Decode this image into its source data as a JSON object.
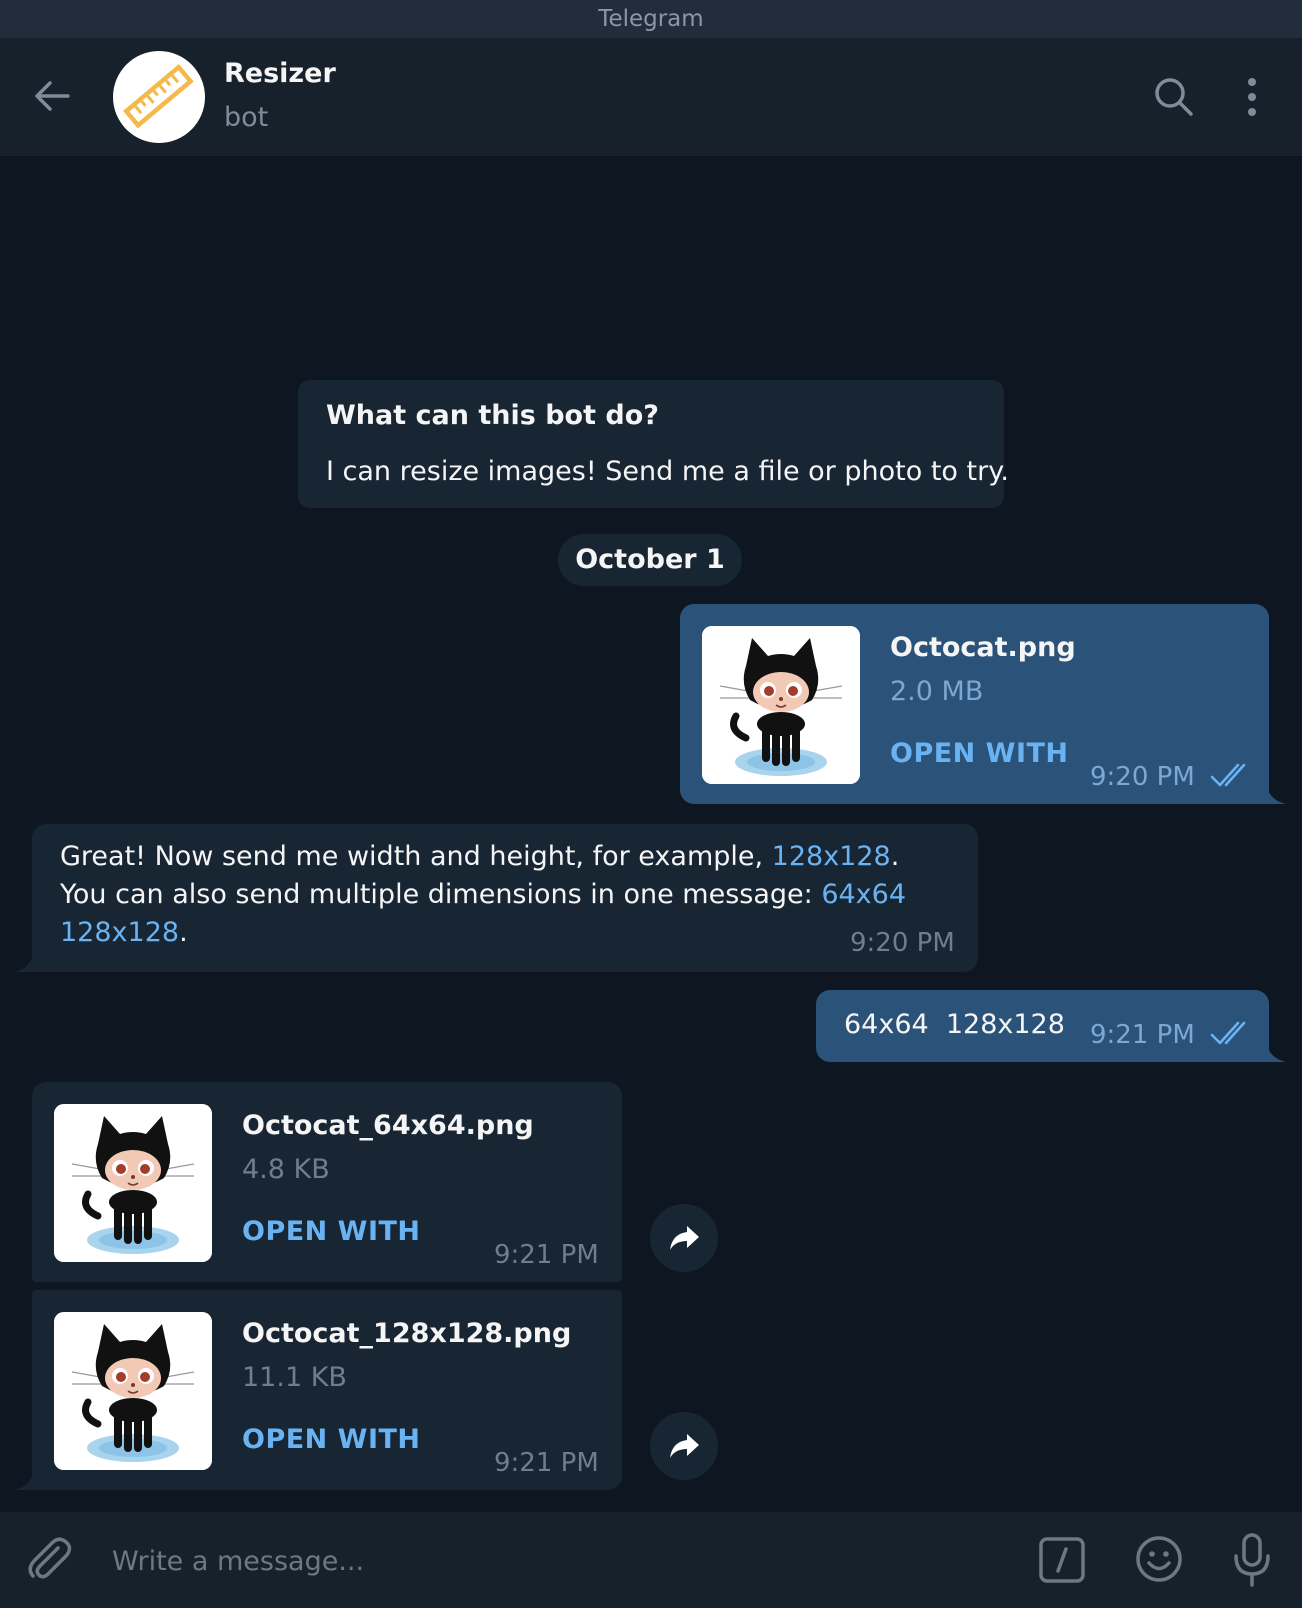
{
  "window": {
    "title": "Telegram"
  },
  "header": {
    "name": "Resizer",
    "status": "bot",
    "icons": [
      "arrow-left-icon",
      "ruler-icon",
      "search-icon",
      "more-vertical-icon"
    ]
  },
  "intro": {
    "title": "What can this bot do?",
    "text": "I can resize images! Send me a file or photo to try."
  },
  "date_divider": "October 1",
  "messages": [
    {
      "type": "file",
      "direction": "out",
      "file_name": "Octocat.png",
      "file_size": "2.0 MB",
      "action": "OPEN WITH",
      "time": "9:20 PM",
      "status": "read"
    },
    {
      "type": "text",
      "direction": "in",
      "parts": {
        "p1": "Great! Now send me width and height, for example, ",
        "link1": "128x128",
        "p2": ". You can also send multiple dimensions in one message: ",
        "link2": "64x64",
        "link3": "128x128",
        "p3": "."
      },
      "time": "9:20 PM"
    },
    {
      "type": "text",
      "direction": "out",
      "text": "64x64  128x128",
      "time": "9:21 PM",
      "status": "read"
    },
    {
      "type": "file",
      "direction": "in",
      "file_name": "Octocat_64x64.png",
      "file_size": "4.8 KB",
      "action": "OPEN WITH",
      "time": "9:21 PM"
    },
    {
      "type": "file",
      "direction": "in",
      "file_name": "Octocat_128x128.png",
      "file_size": "11.1 KB",
      "action": "OPEN WITH",
      "time": "9:21 PM"
    }
  ],
  "composer": {
    "placeholder": "Write a message...",
    "icons": [
      "paperclip-icon",
      "slash-command-icon",
      "emoji-icon",
      "microphone-icon"
    ]
  },
  "colors": {
    "background": "#0e1621",
    "header": "#17212b",
    "incoming_bubble": "#182533",
    "outgoing_bubble": "#2b5278",
    "link": "#6ab3f3"
  }
}
